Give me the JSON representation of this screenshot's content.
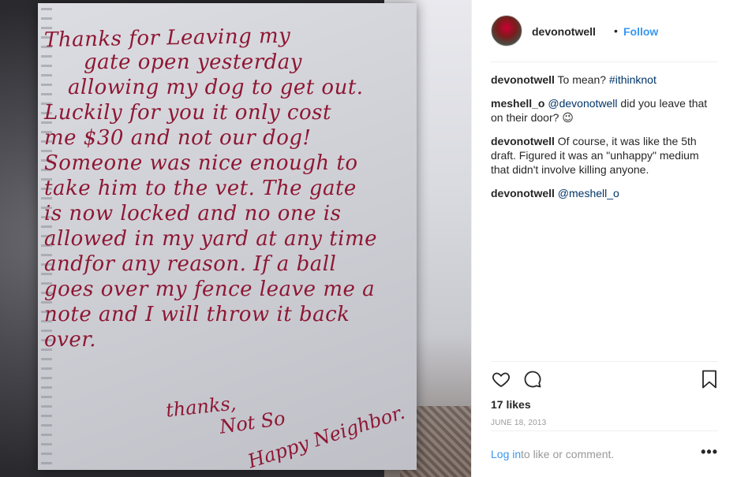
{
  "post": {
    "username": "devonotwell",
    "separator": "•",
    "follow_label": "Follow",
    "photo": {
      "note_lines": [
        "Thanks for Leaving my",
        "gate open yesterday",
        "allowing my dog to get out.",
        "Luckily for you it only cost",
        "me $30 and not our dog!",
        "Someone was nice enough to",
        "take him to the vet. The gate",
        "is now locked and no one is",
        "allowed in my yard at any time",
        "andfor any reason. If a ball",
        "goes over my fence leave me a",
        "note and I will throw it back",
        "over."
      ],
      "signoff": [
        "thanks,",
        "Not So",
        "Happy Neighbor."
      ]
    },
    "comments": [
      {
        "user": "devonotwell",
        "text": "To mean?",
        "tag": "#ithinknot"
      },
      {
        "user": "meshell_o",
        "tag": "@devonotwell",
        "text": "did you leave that on their door? 😉"
      },
      {
        "user": "devonotwell",
        "text": "Of course, it was like the 5th draft. Figured it was an \"unhappy\" medium that didn't involve killing anyone."
      },
      {
        "user": "devonotwell",
        "tag": "@meshell_o"
      }
    ],
    "likes": "17 likes",
    "date": "JUNE 18, 2013",
    "footer": {
      "login": "Log in",
      "rest": "to like or comment.",
      "more": "•••"
    },
    "icons": [
      "heart-icon",
      "comment-icon",
      "bookmark-icon",
      "more-icon"
    ]
  }
}
